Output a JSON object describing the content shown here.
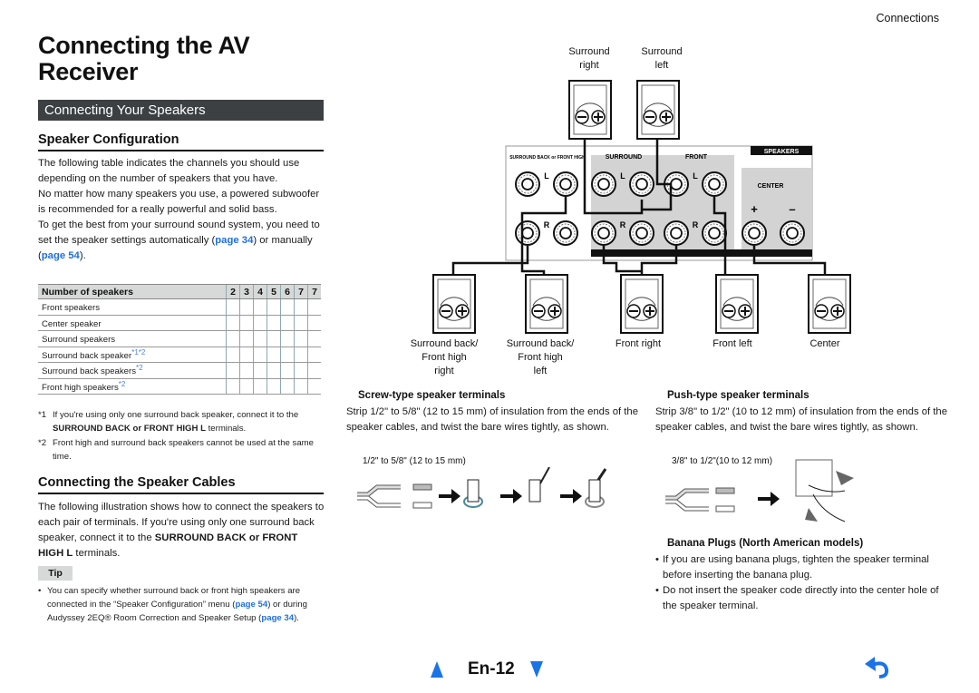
{
  "header": {
    "section": "Connections"
  },
  "title": "Connecting the AV Receiver",
  "section_bar": "Connecting Your Speakers",
  "speaker_config": {
    "heading": "Speaker Configuration",
    "para1": "The following table indicates the channels you should use depending on the number of speakers that you have.",
    "para2": "No matter how many speakers you use, a powered subwoofer is recommended for a really powerful and solid bass.",
    "para3_pre": "To get the best from your surround sound system, you need to set the speaker settings automatically (",
    "para3_link1": "page 34",
    "para3_mid": ") or manually (",
    "para3_link2": "page 54",
    "para3_post": ")."
  },
  "table": {
    "header_label": "Number of speakers",
    "columns": [
      "2",
      "3",
      "4",
      "5",
      "6",
      "7",
      "7"
    ],
    "rows": [
      {
        "label": "Front speakers",
        "note": ""
      },
      {
        "label": "Center speaker",
        "note": ""
      },
      {
        "label": "Surround speakers",
        "note": ""
      },
      {
        "label": "Surround back speaker",
        "note": "*1*2"
      },
      {
        "label": "Surround back speakers",
        "note": "*2"
      },
      {
        "label": "Front high speakers",
        "note": "*2"
      }
    ]
  },
  "footnotes": {
    "fn1_mark": "*1",
    "fn1_pre": "If you're using only one surround back speaker, connect it to the ",
    "fn1_bold": "SURROUND BACK or FRONT HIGH L",
    "fn1_post": " terminals.",
    "fn2_mark": "*2",
    "fn2_text": "Front high and surround back speakers cannot be used at the same time."
  },
  "cables": {
    "heading": "Connecting the Speaker Cables",
    "para_pre": "The following illustration shows how to connect the speakers to each pair of terminals. If you're using only one surround back speaker, connect it to the ",
    "para_bold": "SURROUND BACK or FRONT HIGH L",
    "para_post": " terminals."
  },
  "tip": {
    "label": "Tip",
    "text_pre": "You can specify whether surround back or front high speakers are connected in the “Speaker Configuration” menu (",
    "link1": "page 54",
    "text_mid": ") or during Audyssey 2EQ® Room Correction and Speaker Setup (",
    "link2": "page 34",
    "text_post": ")."
  },
  "diagram": {
    "top_speakers": [
      {
        "line1": "Surround",
        "line2": "right"
      },
      {
        "line1": "Surround",
        "line2": "left"
      }
    ],
    "bottom_speakers": [
      {
        "line1": "Surround back/",
        "line2": "Front high",
        "line3": "right"
      },
      {
        "line1": "Surround back/",
        "line2": "Front high",
        "line3": "left"
      },
      {
        "line1": "Front right",
        "line2": "",
        "line3": ""
      },
      {
        "line1": "Front left",
        "line2": "",
        "line3": ""
      },
      {
        "line1": "Center",
        "line2": "",
        "line3": ""
      }
    ],
    "panel": {
      "title": "SPEAKERS",
      "group1": "SURROUND BACK or FRONT HIGH",
      "group2": "SURROUND",
      "group3": "FRONT",
      "group4": "CENTER",
      "L": "L",
      "R": "R",
      "plus": "+",
      "minus": "–"
    }
  },
  "screw": {
    "heading": "Screw-type speaker terminals",
    "text": "Strip 1/2\" to 5/8\" (12 to 15 mm) of insulation from the ends of the speaker cables, and twist the bare wires tightly, as shown.",
    "measure": "1/2\" to 5/8\" (12 to 15 mm)"
  },
  "push": {
    "heading": "Push-type speaker terminals",
    "text": "Strip 3/8\" to 1/2\" (10 to 12 mm) of insulation from the ends of the speaker cables, and twist the bare wires tightly, as shown.",
    "measure": "3/8\" to 1/2\"(10 to 12 mm)"
  },
  "banana": {
    "heading": "Banana Plugs (North American models)",
    "bullets": [
      "If you are using banana plugs, tighten the speaker terminal before inserting the banana plug.",
      "Do not insert the speaker code directly into the center hole of the speaker terminal."
    ]
  },
  "footer": {
    "page": "En-12",
    "accent": "#1a73e8"
  }
}
